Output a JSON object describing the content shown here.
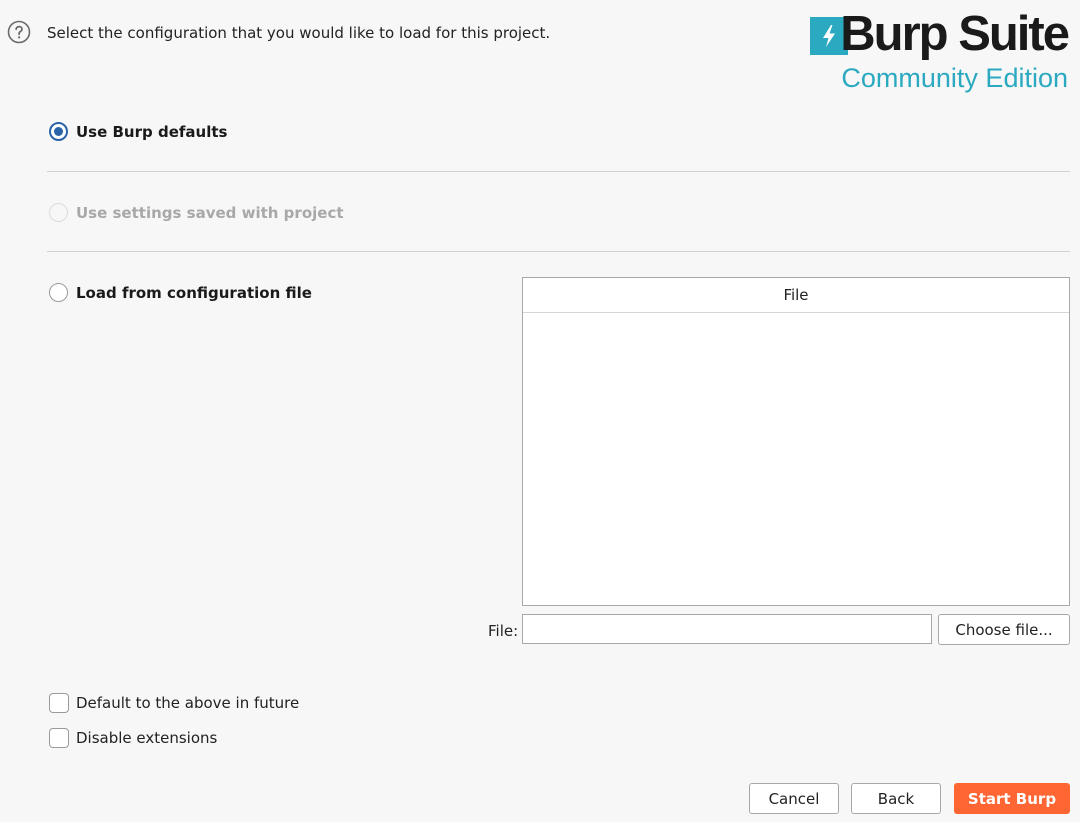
{
  "header": {
    "help_icon": "question-circle-icon",
    "instruction": "Select the configuration that you would like to load for this project."
  },
  "logo": {
    "mark_icon": "burp-bolt-icon",
    "title": "Burp Suite",
    "subtitle": "Community Edition",
    "accent_color": "#2aa9c0"
  },
  "options": {
    "defaults": {
      "label": "Use Burp defaults",
      "selected": true,
      "enabled": true
    },
    "project": {
      "label": "Use settings saved with project",
      "selected": false,
      "enabled": false
    },
    "config_file": {
      "label": "Load from configuration file",
      "selected": false,
      "enabled": true
    }
  },
  "file_table": {
    "column_header": "File",
    "rows": []
  },
  "file_field": {
    "label": "File:",
    "value": "",
    "choose_label": "Choose file..."
  },
  "checkboxes": {
    "default_future": {
      "label": "Default to the above in future",
      "checked": false
    },
    "disable_extensions": {
      "label": "Disable extensions",
      "checked": false
    }
  },
  "footer": {
    "cancel_label": "Cancel",
    "back_label": "Back",
    "start_label": "Start Burp",
    "start_color": "#ff6633"
  }
}
